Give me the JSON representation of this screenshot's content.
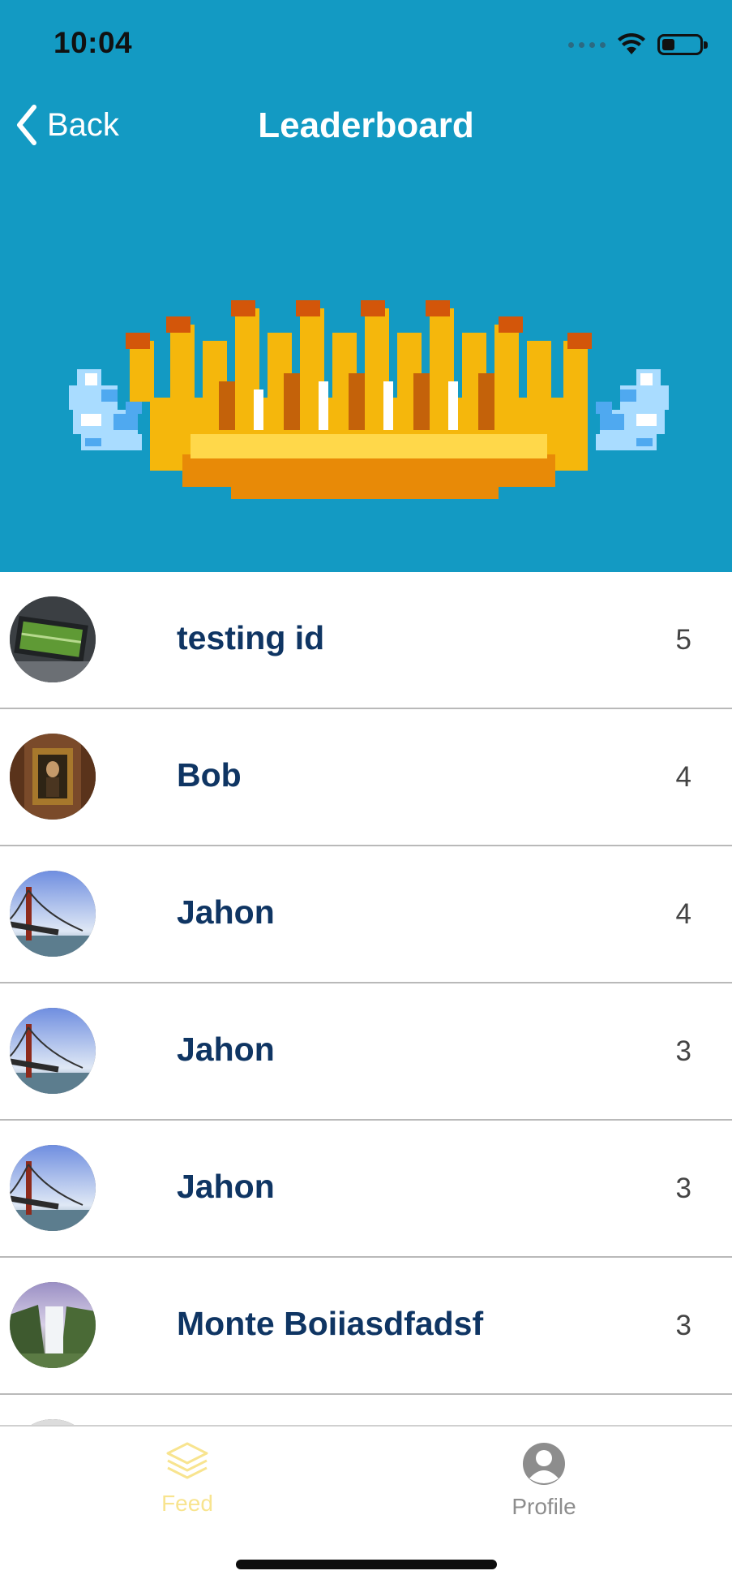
{
  "status_bar": {
    "time": "10:04"
  },
  "nav": {
    "back_label": "Back",
    "title": "Leaderboard"
  },
  "leaderboard": {
    "rows": [
      {
        "name": "testing id",
        "score": "5",
        "avatar": "soccer-field-photo"
      },
      {
        "name": "Bob",
        "score": "4",
        "avatar": "framed-painting-photo"
      },
      {
        "name": "Jahon",
        "score": "4",
        "avatar": "golden-gate-bridge-photo"
      },
      {
        "name": "Jahon",
        "score": "3",
        "avatar": "golden-gate-bridge-photo"
      },
      {
        "name": "Jahon",
        "score": "3",
        "avatar": "golden-gate-bridge-photo"
      },
      {
        "name": "Monte Boiiasdfadsf",
        "score": "3",
        "avatar": "waterfall-photo"
      }
    ]
  },
  "tabs": {
    "feed_label": "Feed",
    "profile_label": "Profile",
    "active": "Feed"
  },
  "colors": {
    "header_bg": "#139ac3",
    "name_text": "#0f3563",
    "active_tab": "#f8e48f",
    "inactive_tab": "#8d8d8d"
  }
}
